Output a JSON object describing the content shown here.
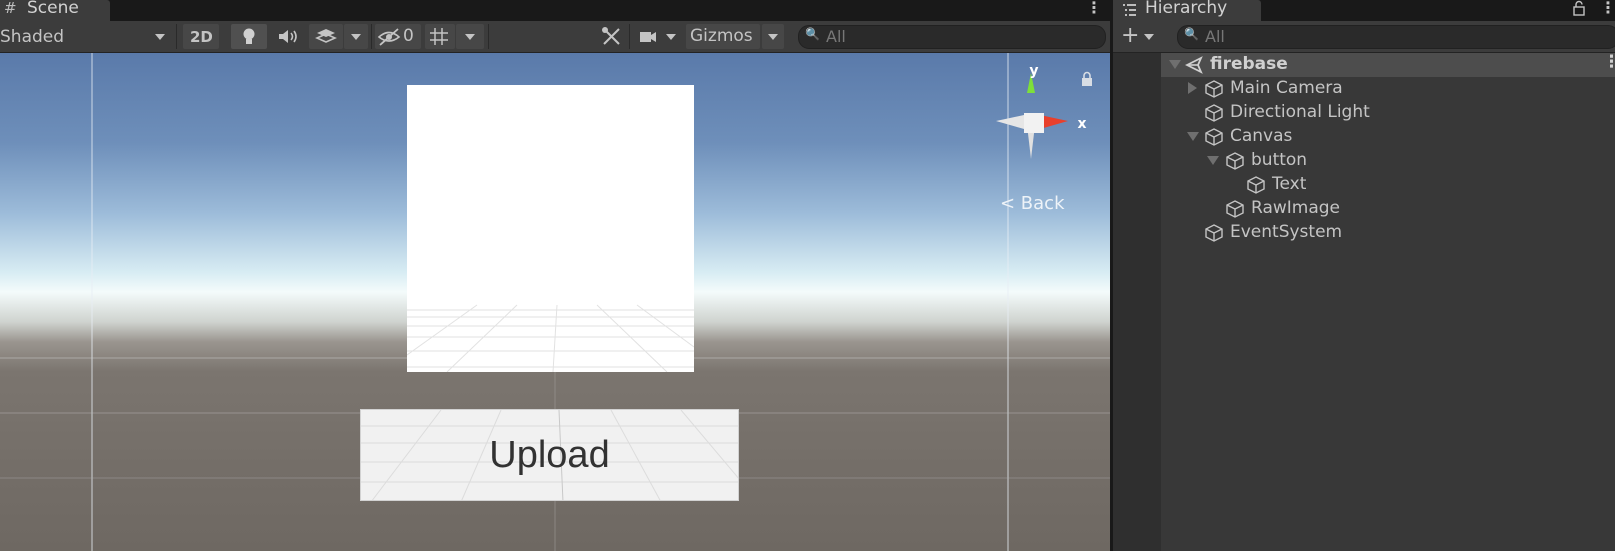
{
  "scene": {
    "tab_label": "Scene",
    "tab_icon": "hash-icon",
    "shading_mode": "Shaded",
    "mode_2d_label": "2D",
    "hidden_count": "0",
    "gizmos_label": "Gizmos",
    "search_placeholder": "All",
    "back_label": "< Back",
    "axis_x": "x",
    "axis_y": "y"
  },
  "game_ui": {
    "upload_button_text": "Upload"
  },
  "hierarchy": {
    "tab_label": "Hierarchy",
    "search_placeholder": "All",
    "items": [
      {
        "label": "firebase",
        "depth": 0,
        "expanded": true,
        "icon": "unity-scene-icon"
      },
      {
        "label": "Main Camera",
        "depth": 1,
        "expanded": false,
        "icon": "cube-icon"
      },
      {
        "label": "Directional Light",
        "depth": 1,
        "icon": "cube-icon"
      },
      {
        "label": "Canvas",
        "depth": 1,
        "expanded": true,
        "icon": "cube-icon"
      },
      {
        "label": "button",
        "depth": 2,
        "expanded": true,
        "icon": "cube-icon"
      },
      {
        "label": "Text",
        "depth": 3,
        "icon": "cube-icon"
      },
      {
        "label": "RawImage",
        "depth": 2,
        "icon": "cube-icon"
      },
      {
        "label": "EventSystem",
        "depth": 1,
        "icon": "cube-icon"
      }
    ]
  },
  "colors": {
    "panel_bg": "#383838",
    "toolbar_bg": "#3c3c3c",
    "selected_row": "#4d4d4d",
    "gizmo_x": "#e8402c",
    "gizmo_y": "#7ee03a"
  }
}
